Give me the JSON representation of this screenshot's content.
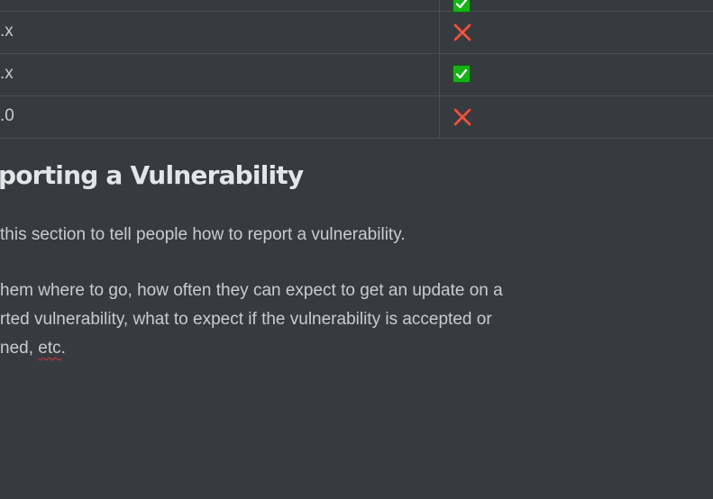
{
  "table": {
    "rows": [
      {
        "version": "",
        "supported": true
      },
      {
        "version": ".x",
        "supported": false
      },
      {
        "version": ".x",
        "supported": true
      },
      {
        "version": ".0",
        "supported": false
      }
    ]
  },
  "section": {
    "heading": "porting a Vulnerability",
    "paragraph1": "this section to tell people how to report a vulnerability.",
    "paragraph2_line1": "hem where to go, how often they can expect to get an update on a",
    "paragraph2_line2": "rted vulnerability, what to expect if the vulnerability is accepted or",
    "paragraph2_line3_prefix": "ned, ",
    "paragraph2_line3_misspelled": "etc",
    "paragraph2_line3_suffix": "."
  },
  "colors": {
    "background": "#373b40",
    "border": "#4a4f55",
    "check": "#16b316",
    "cross": "#e0452f"
  },
  "icons": {
    "supported": "check-mark-icon",
    "unsupported": "cross-mark-icon"
  }
}
